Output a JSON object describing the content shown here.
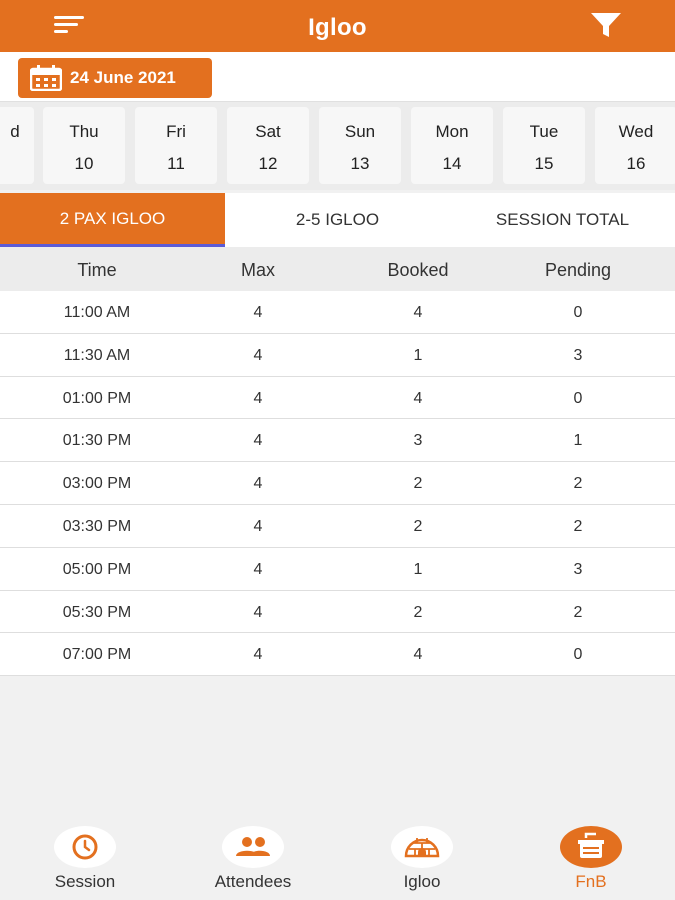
{
  "header": {
    "title": "Igloo"
  },
  "date_picker": {
    "label": "24 June 2021"
  },
  "days": [
    {
      "name": "d",
      "num": ""
    },
    {
      "name": "Thu",
      "num": "10"
    },
    {
      "name": "Fri",
      "num": "11"
    },
    {
      "name": "Sat",
      "num": "12"
    },
    {
      "name": "Sun",
      "num": "13"
    },
    {
      "name": "Mon",
      "num": "14"
    },
    {
      "name": "Tue",
      "num": "15"
    },
    {
      "name": "Wed",
      "num": "16"
    }
  ],
  "tabs": [
    {
      "label": "2 PAX IGLOO",
      "active": true
    },
    {
      "label": "2-5 IGLOO",
      "active": false
    },
    {
      "label": "SESSION TOTAL",
      "active": false
    }
  ],
  "table": {
    "headers": [
      "Time",
      "Max",
      "Booked",
      "Pending"
    ],
    "rows": [
      [
        "11:00 AM",
        "4",
        "4",
        "0"
      ],
      [
        "11:30 AM",
        "4",
        "1",
        "3"
      ],
      [
        "01:00 PM",
        "4",
        "4",
        "0"
      ],
      [
        "01:30 PM",
        "4",
        "3",
        "1"
      ],
      [
        "03:00 PM",
        "4",
        "2",
        "2"
      ],
      [
        "03:30 PM",
        "4",
        "2",
        "2"
      ],
      [
        "05:00 PM",
        "4",
        "1",
        "3"
      ],
      [
        "05:30 PM",
        "4",
        "2",
        "2"
      ],
      [
        "07:00 PM",
        "4",
        "4",
        "0"
      ]
    ]
  },
  "bottom_nav": [
    {
      "label": "Session",
      "icon": "clock-icon",
      "active": false
    },
    {
      "label": "Attendees",
      "icon": "people-icon",
      "active": false
    },
    {
      "label": "Igloo",
      "icon": "igloo-icon",
      "active": false
    },
    {
      "label": "FnB",
      "icon": "food-icon",
      "active": true
    }
  ],
  "colors": {
    "accent": "#e3701f",
    "tab_indicator": "#5b5bd6"
  }
}
